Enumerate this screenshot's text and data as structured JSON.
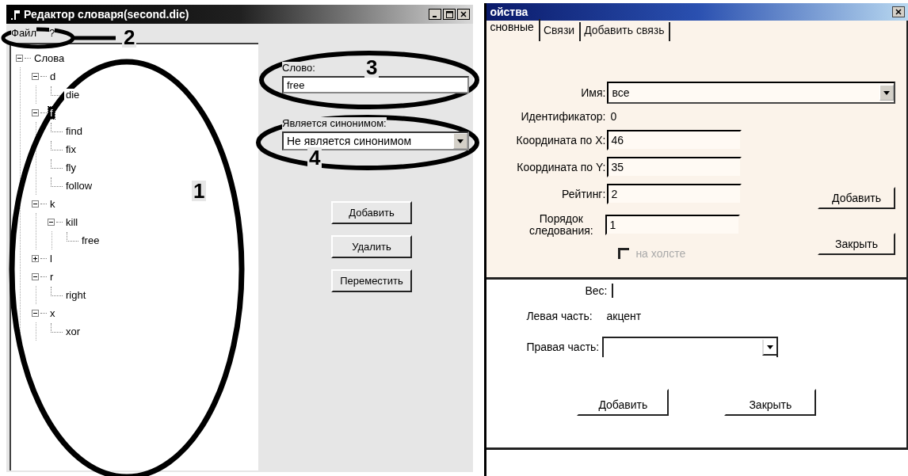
{
  "editor_window": {
    "title": "Редактор словаря(second.dic)",
    "menu": [
      {
        "label": "Файл"
      },
      {
        "label": "?"
      }
    ],
    "tree": [
      {
        "label": "Слова",
        "expanded": true,
        "selected": false,
        "children": [
          {
            "label": "d",
            "expanded": true,
            "selected": false,
            "children": [
              {
                "label": "die",
                "selected": false
              }
            ]
          },
          {
            "label": "f",
            "expanded": true,
            "selected": true,
            "children": [
              {
                "label": "find",
                "selected": false
              },
              {
                "label": "fix",
                "selected": false
              },
              {
                "label": "fly",
                "selected": false
              },
              {
                "label": "follow",
                "selected": false
              }
            ]
          },
          {
            "label": "k",
            "expanded": true,
            "selected": false,
            "children": [
              {
                "label": "kill",
                "expanded": true,
                "selected": false,
                "children": [
                  {
                    "label": "free",
                    "selected": false
                  }
                ]
              }
            ]
          },
          {
            "label": "l",
            "expanded": false,
            "selected": false
          },
          {
            "label": "r",
            "expanded": true,
            "selected": false,
            "children": [
              {
                "label": "right",
                "selected": false
              }
            ]
          },
          {
            "label": "x",
            "expanded": true,
            "selected": false,
            "children": [
              {
                "label": "xor",
                "selected": false
              }
            ]
          }
        ]
      }
    ],
    "word_label": "Слово:",
    "word_value": "free",
    "synonym_label": "Является синонимом:",
    "synonym_value": "Не является синонимом",
    "buttons": [
      "Добавить",
      "Удалить",
      "Переместить"
    ]
  },
  "properties_dialog": {
    "title": "ойства",
    "tabs": [
      {
        "label": "сновные",
        "selected": true
      },
      {
        "label": "Связи",
        "selected": false
      },
      {
        "label": "Добавить связь",
        "selected": false
      }
    ],
    "name_label": "Имя:",
    "name_value": "все",
    "fields": [
      {
        "kind": "text",
        "label": "Идентификатор:",
        "value": "0"
      },
      {
        "kind": "input",
        "label": "Координата по X:",
        "value": "46"
      },
      {
        "kind": "input",
        "label": "Координата по Y:",
        "value": "35"
      },
      {
        "kind": "input",
        "label": "Рейтинг:",
        "value": "2"
      },
      {
        "kind": "wrapped",
        "label": "Порядок следования:",
        "value": "1"
      }
    ],
    "checkbox": {
      "label": "на холсте",
      "checked": false,
      "disabled": true
    },
    "side_buttons": [
      "Добавить",
      "Закрыть"
    ]
  },
  "link_dialog": {
    "weight_label": "Вес:",
    "left_label": "Левая часть:",
    "left_value": "акцент",
    "right_label": "Правая часть:",
    "buttons": [
      "Добавить",
      "Закрыть"
    ]
  },
  "annotations": [
    {
      "label": "1"
    },
    {
      "label": "2"
    },
    {
      "label": "3"
    },
    {
      "label": "4"
    }
  ]
}
